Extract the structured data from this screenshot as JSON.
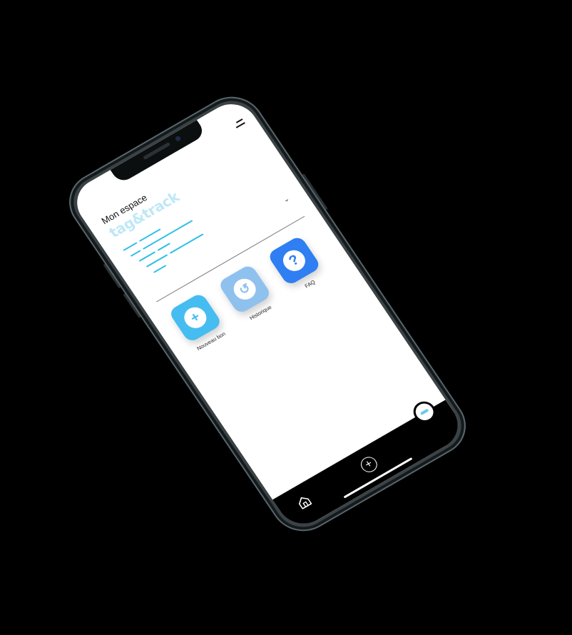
{
  "screen": {
    "title": "Mon espace",
    "brand": "tag&track"
  },
  "select": {
    "chevron": "⌄"
  },
  "tiles": [
    {
      "label": "Nouveau bon",
      "icon": "plus-icon",
      "glyph": "+",
      "color": "#46bdf0"
    },
    {
      "label": "Historique",
      "icon": "history-icon",
      "glyph": "↺",
      "color": "#8fc1ee"
    },
    {
      "label": "FAQ",
      "icon": "question-icon",
      "glyph": "?",
      "color": "#2f7ef2"
    }
  ],
  "tabbar": {
    "home_icon": "home-icon",
    "add_icon": "plus-circle-icon",
    "add_glyph": "+",
    "profile_icon": "avatar-icon"
  },
  "colors": {
    "accent": "#2fc0e6",
    "brand": "#bfe8f6",
    "background": "#000000"
  }
}
